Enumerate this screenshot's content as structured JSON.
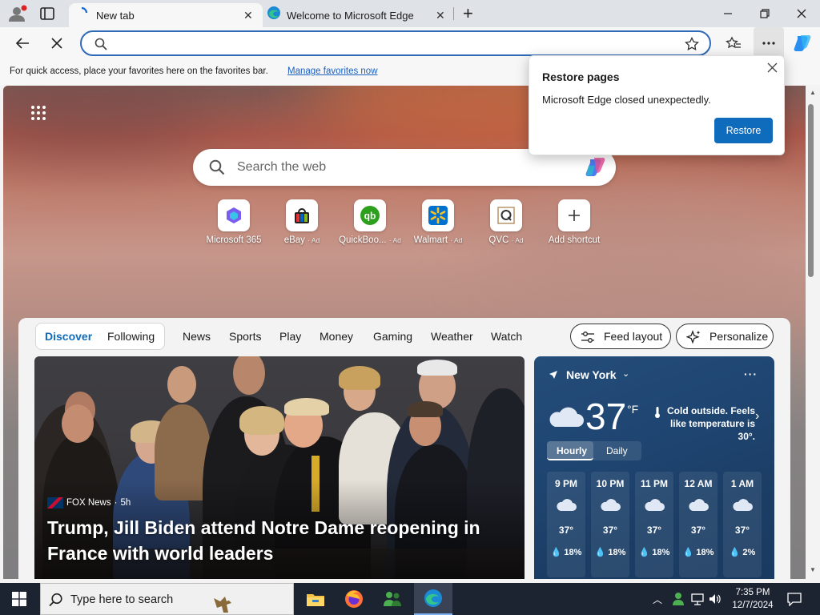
{
  "browser": {
    "tabs": [
      {
        "label": "New tab",
        "active": true
      },
      {
        "label": "Welcome to Microsoft Edge",
        "active": false
      }
    ],
    "new_tab_symbol": "+",
    "address_value": "",
    "favorites_hint": "For quick access, place your favorites here on the favorites bar.",
    "favorites_link": "Manage favorites now"
  },
  "popup": {
    "title": "Restore pages",
    "message": "Microsoft Edge closed unexpectedly.",
    "button": "Restore"
  },
  "newtab": {
    "search_placeholder": "Search the web",
    "shortcuts": [
      {
        "name": "Microsoft 365",
        "ad": ""
      },
      {
        "name": "eBay",
        "ad": "· Ad"
      },
      {
        "name": "QuickBoo...",
        "ad": "· Ad"
      },
      {
        "name": "Walmart",
        "ad": "· Ad"
      },
      {
        "name": "QVC",
        "ad": "· Ad"
      },
      {
        "name": "Add shortcut",
        "ad": ""
      }
    ]
  },
  "feed": {
    "tabs_grouped": [
      "Discover",
      "Following"
    ],
    "tabs": [
      "News",
      "Sports",
      "Play",
      "Money",
      "Gaming",
      "Weather",
      "Watch"
    ],
    "feed_layout_button": "Feed layout",
    "personalize_button": "Personalize",
    "hero": {
      "source": "FOX News",
      "age": "5h",
      "headline_line1": "Trump, Jill Biden attend Notre Dame reopening in",
      "headline_line2": "France with world leaders"
    }
  },
  "weather": {
    "location": "New York",
    "temperature": "37",
    "unit": "°F",
    "summary_line1": "Cold outside. Feels",
    "summary_line2": "like temperature is 30°.",
    "tabs": [
      "Hourly",
      "Daily"
    ],
    "hourly": [
      {
        "time": "9 PM",
        "temp": "37°",
        "precip": "18%"
      },
      {
        "time": "10 PM",
        "temp": "37°",
        "precip": "18%"
      },
      {
        "time": "11 PM",
        "temp": "37°",
        "precip": "18%"
      },
      {
        "time": "12 AM",
        "temp": "37°",
        "precip": "18%"
      },
      {
        "time": "1 AM",
        "temp": "37°",
        "precip": "2%"
      }
    ]
  },
  "taskbar": {
    "search_placeholder": "Type here to search",
    "time": "7:35 PM",
    "date": "12/7/2024"
  },
  "colors": {
    "accent": "#0f6cbd",
    "link": "#1b5fbf",
    "discover": "#0f6cbd",
    "taskbar": "#1c2331"
  }
}
